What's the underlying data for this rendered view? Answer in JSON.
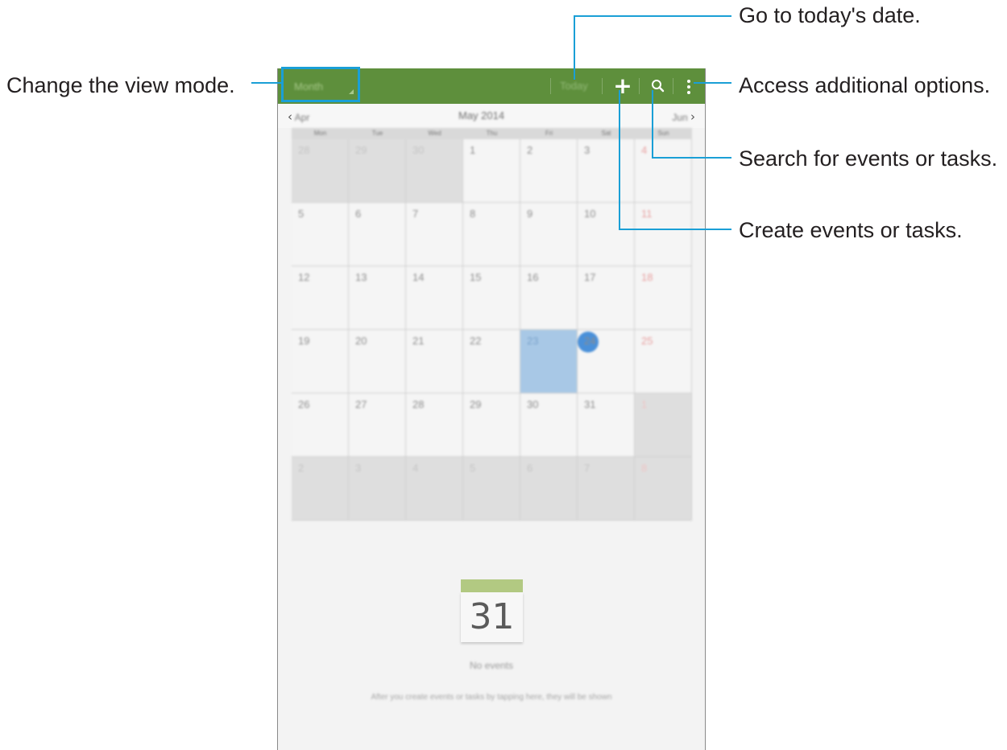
{
  "callouts": {
    "view_mode": "Change the view mode.",
    "today": "Go to today's date.",
    "more_options": "Access additional options.",
    "search": "Search for events or tasks.",
    "create": "Create events or tasks."
  },
  "action_bar": {
    "view_mode_label": "Month",
    "today_label": "Today",
    "add_icon": "plus-icon",
    "search_icon": "search-icon",
    "more_icon": "more-vertical-icon",
    "color": "#5e8f3c"
  },
  "month_nav": {
    "prev_label": "Apr",
    "title": "May 2014",
    "next_label": "Jun"
  },
  "weekdays": [
    "Mon",
    "Tue",
    "Wed",
    "Thu",
    "Fri",
    "Sat",
    "Sun"
  ],
  "weeks": [
    [
      "28",
      "29",
      "30",
      "1",
      "2",
      "3",
      "4"
    ],
    [
      "5",
      "6",
      "7",
      "8",
      "9",
      "10",
      "11"
    ],
    [
      "12",
      "13",
      "14",
      "15",
      "16",
      "17",
      "18"
    ],
    [
      "19",
      "20",
      "21",
      "22",
      "23",
      "24",
      "25"
    ],
    [
      "26",
      "27",
      "28",
      "29",
      "30",
      "31",
      "1"
    ],
    [
      "2",
      "3",
      "4",
      "5",
      "6",
      "7",
      "8"
    ]
  ],
  "selected_date": "23",
  "today_date": "24",
  "empty_state": {
    "icon_number": "31",
    "no_events": "No events",
    "hint": "After you create events or tasks by tapping here, they will be shown"
  }
}
